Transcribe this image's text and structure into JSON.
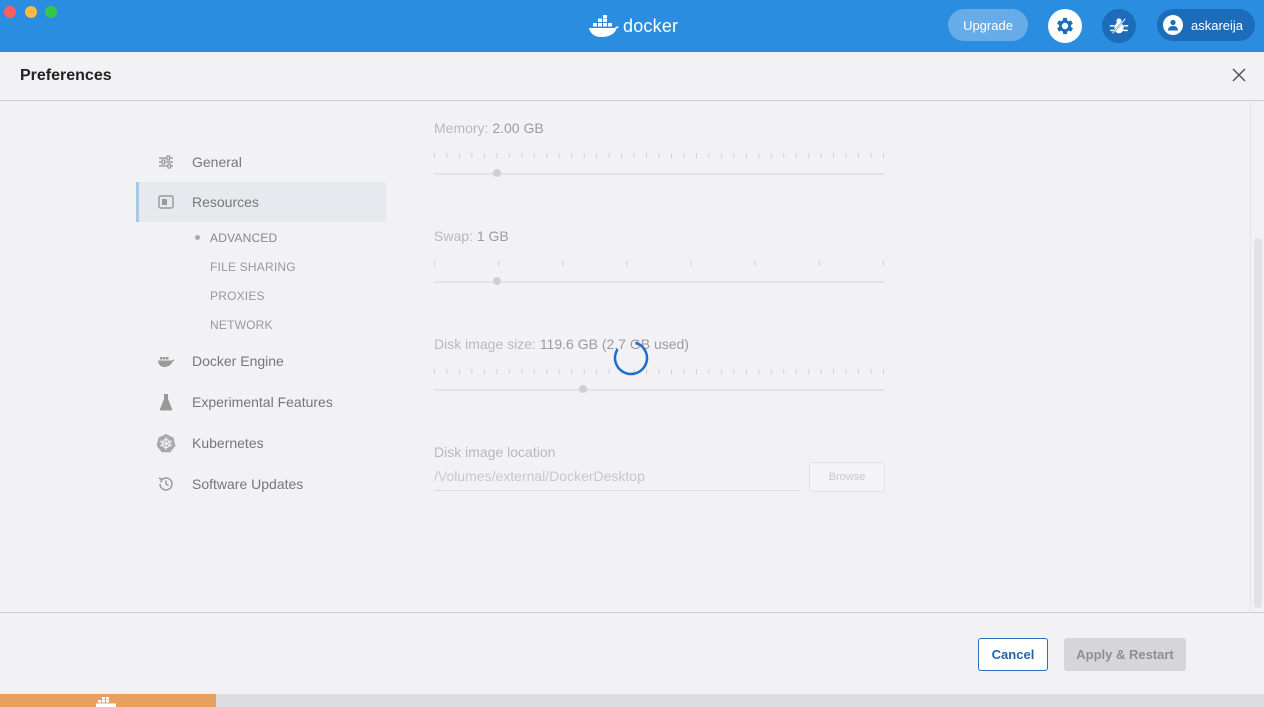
{
  "topbar": {
    "brand": "docker",
    "upgrade_label": "Upgrade",
    "account_name": "askareija",
    "accent_color": "#2a8ddf"
  },
  "header": {
    "title": "Preferences"
  },
  "sidebar": {
    "items": [
      {
        "label": "General",
        "icon": "sliders-icon"
      },
      {
        "label": "Resources",
        "icon": "resources-icon",
        "active": true
      },
      {
        "label": "Docker Engine",
        "icon": "whale-icon"
      },
      {
        "label": "Experimental Features",
        "icon": "flask-icon"
      },
      {
        "label": "Kubernetes",
        "icon": "kubernetes-icon"
      },
      {
        "label": "Software Updates",
        "icon": "history-icon"
      }
    ],
    "subitems": [
      {
        "label": "ADVANCED",
        "active": true
      },
      {
        "label": "FILE SHARING"
      },
      {
        "label": "PROXIES"
      },
      {
        "label": "NETWORK"
      }
    ]
  },
  "resources": {
    "memory": {
      "label": "Memory:",
      "value": "2.00 GB",
      "fraction": 0.14
    },
    "swap": {
      "label": "Swap:",
      "value": "1 GB",
      "fraction": 0.14
    },
    "disk": {
      "label": "Disk image size:",
      "value": "119.6 GB (2.7 GB used)",
      "fraction": 0.33
    },
    "location": {
      "label": "Disk image location",
      "path": "/Volumes/external/DockerDesktop",
      "browse_label": "Browse"
    }
  },
  "footer": {
    "cancel_label": "Cancel",
    "apply_label": "Apply & Restart"
  }
}
